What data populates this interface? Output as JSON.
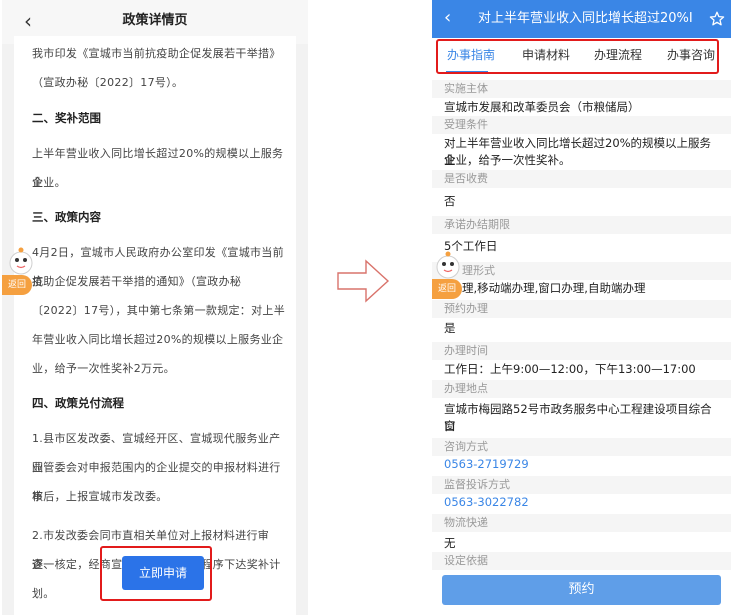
{
  "left": {
    "back_glyph": "‹",
    "title": "政策详情页",
    "paragraphs": {
      "p1_line1": "我市印发《宣城市当前抗疫助企促发展若干举措》",
      "p1_line2": "（宣政办秘〔2022〕17号）。",
      "h2": "二、奖补范围",
      "p2_line1": "上半年营业收入同比增长超过20%的规模以上服务业",
      "p2_line2": "企业。",
      "h3": "三、政策内容",
      "p3_line1": "4月2日，宣城市人民政府办公室印发《宣城市当前抗",
      "p3_line2": "疫助企促发展若干举措的通知》（宣政办秘",
      "p3_line3": "〔2022〕17号），其中第七条第一款规定：对上半",
      "p3_line4": "年营业收入同比增长超过20%的规模以上服务业企",
      "p3_line5": "业，给予一次性奖补2万元。",
      "h4": "四、政策兑付流程",
      "p4_line1": "1.县市区发改委、宣城经开区、宣城现代服务业产业",
      "p4_line2": "园管委会对申报范围内的企业提交的申报材料进行审",
      "p4_line3": "核后，上报宣城市发改委。",
      "p5_line1": "2.市发改委会同市直相关单位对上报材料进行审查、",
      "p5_line2": "逐一核定，经商宣城市财政局，按程序下达奖补计",
      "p5_line3": "划。"
    },
    "apply_label": "立即申请",
    "return_label": "返回"
  },
  "right": {
    "back_glyph": "‹",
    "title": "对上半年营业收入同比增长超过20%",
    "title_suffix": "I",
    "tabs": [
      "办事指南",
      "申请材料",
      "办理流程",
      "办事咨询"
    ],
    "fields": [
      {
        "label": "实施主体",
        "value": "宣城市发展和改革委员会（市粮储局）"
      },
      {
        "label": "受理条件",
        "value_line1": "对上半年营业收入同比增长超过20%的规模以上服务业",
        "value_line2": "企业，给予一次性奖补。"
      },
      {
        "label": "是否收费",
        "value": "否"
      },
      {
        "label": "承诺办结期限",
        "value": "5个工作日"
      },
      {
        "label": "办理形式",
        "label_visible": "理形式",
        "value": "网上办理,移动端办理,窗口办理,自助端办理",
        "value_visible": "理,移动端办理,窗口办理,自助端办理"
      },
      {
        "label": "预约办理",
        "value": "是"
      },
      {
        "label": "办理时间",
        "value": "工作日：上午9:00—12:00，下午13:00—17:00"
      },
      {
        "label": "办理地点",
        "value_line1": "宣城市梅园路52号市政务服务中心工程建设项目综合窗",
        "value_line2": "口"
      },
      {
        "label": "咨询方式",
        "value": "0563-2719729"
      },
      {
        "label": "监督投诉方式",
        "value": "0563-3022782"
      },
      {
        "label": "物流快递",
        "value": "无"
      },
      {
        "label": "设定依据"
      }
    ],
    "reserve_label": "预约",
    "return_label": "返回"
  },
  "colors": {
    "header_blue": "#3a86e6",
    "highlight_red": "#e21b1b",
    "apply_blue": "#2b73e8",
    "return_orange": "#f5a040"
  }
}
